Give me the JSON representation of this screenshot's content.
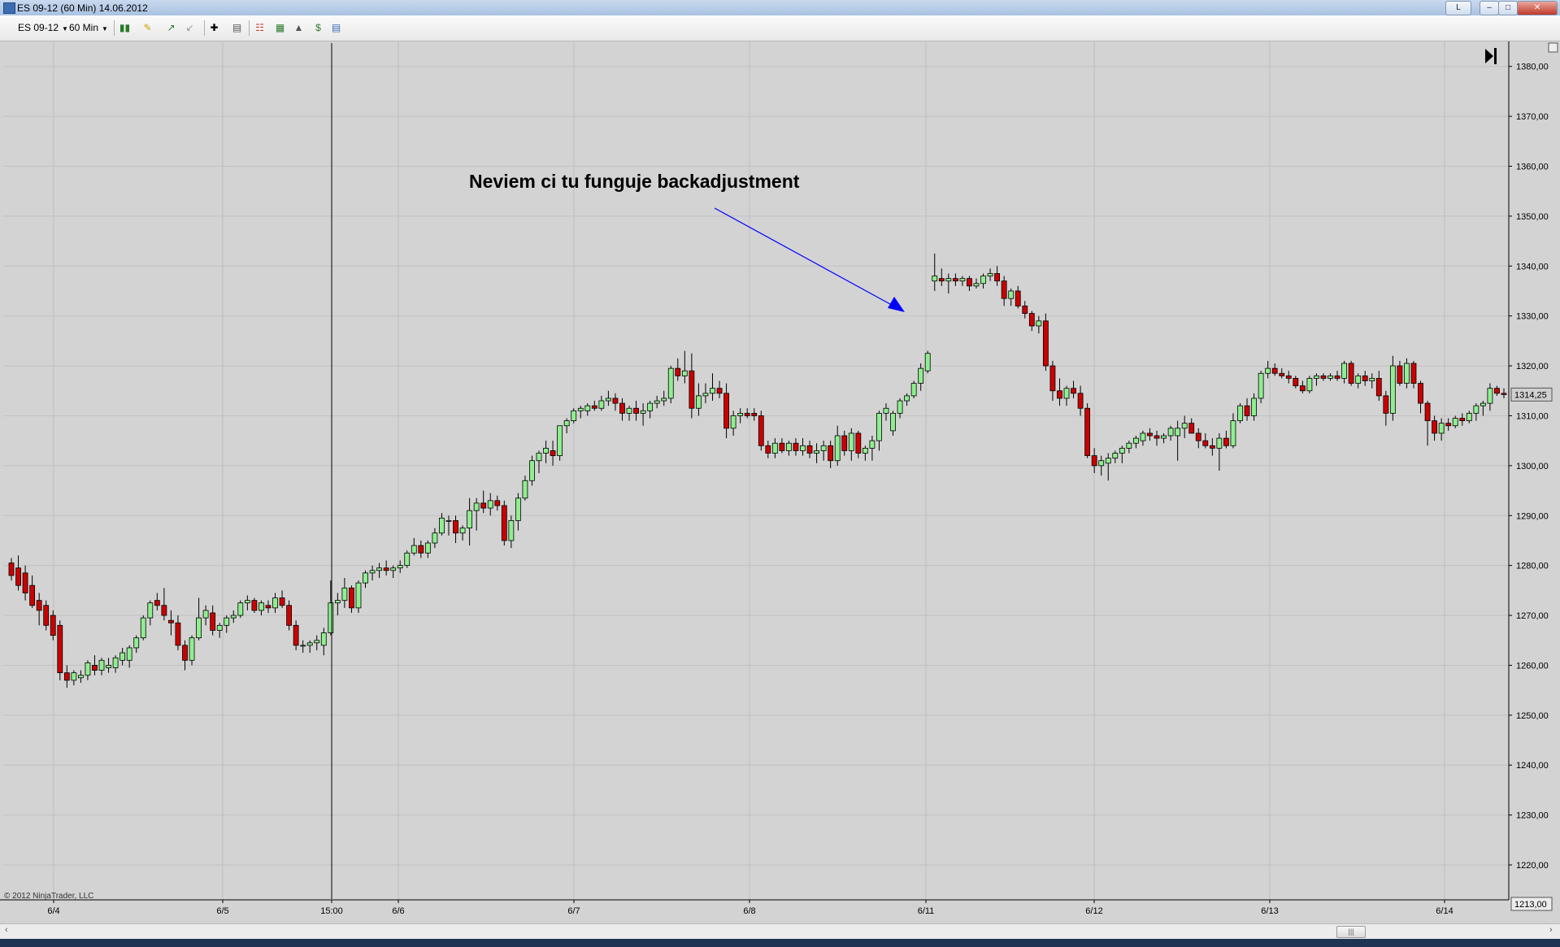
{
  "window": {
    "title": "ES 09-12 (60 Min)  14.06.2012"
  },
  "toolbar": {
    "instrument": "ES 09-12",
    "interval": "60 Min"
  },
  "chart_data": {
    "type": "candlestick",
    "instrument": "ES 09-12",
    "interval": "60 Min",
    "ylim": [
      1213.0,
      1385.0
    ],
    "y_ticks": [
      "1220,00",
      "1230,00",
      "1240,00",
      "1250,00",
      "1260,00",
      "1270,00",
      "1280,00",
      "1290,00",
      "1300,00",
      "1310,00",
      "1320,00",
      "1330,00",
      "1340,00",
      "1350,00",
      "1360,00",
      "1370,00",
      "1380,00"
    ],
    "x_tick_labels": [
      "6/4",
      "6/5",
      "15:00",
      "6/6",
      "6/7",
      "6/8",
      "6/11",
      "6/12",
      "6/13",
      "6/14"
    ],
    "last_price_label": "1314,25",
    "bottom_price_label": "1213,00",
    "annotation_text": "Neviem ci tu funguje backadjustment",
    "copyright": "© 2012 NinjaTrader, LLC",
    "colors": {
      "up": "#90ee90",
      "down": "#cc0000",
      "outline": "#000000",
      "background": "#d3d3d3",
      "arrow": "#0000ff"
    },
    "candles_ohlc": [
      [
        1280.5,
        1281.5,
        1277.0,
        1278.0
      ],
      [
        1279.5,
        1282.0,
        1275.0,
        1276.0
      ],
      [
        1278.5,
        1280.0,
        1273.0,
        1274.5
      ],
      [
        1276.0,
        1278.0,
        1271.5,
        1272.0
      ],
      [
        1273.0,
        1274.5,
        1268.0,
        1271.0
      ],
      [
        1272.0,
        1273.0,
        1267.0,
        1268.0
      ],
      [
        1270.0,
        1271.0,
        1265.0,
        1266.0
      ],
      [
        1268.0,
        1269.0,
        1257.0,
        1258.5
      ],
      [
        1258.5,
        1260.0,
        1255.5,
        1257.0
      ],
      [
        1257.0,
        1259.0,
        1256.0,
        1258.5
      ],
      [
        1257.5,
        1259.0,
        1256.5,
        1258.0
      ],
      [
        1258.0,
        1261.0,
        1257.0,
        1260.5
      ],
      [
        1260.0,
        1262.0,
        1258.0,
        1259.0
      ],
      [
        1259.0,
        1261.5,
        1258.0,
        1261.0
      ],
      [
        1259.5,
        1261.5,
        1258.5,
        1260.0
      ],
      [
        1259.5,
        1262.0,
        1258.5,
        1261.5
      ],
      [
        1261.0,
        1263.5,
        1260.0,
        1262.5
      ],
      [
        1261.0,
        1264.0,
        1259.5,
        1263.5
      ],
      [
        1263.5,
        1266.0,
        1262.5,
        1265.5
      ],
      [
        1265.5,
        1270.0,
        1265.0,
        1269.5
      ],
      [
        1269.5,
        1273.0,
        1268.0,
        1272.5
      ],
      [
        1273.0,
        1274.5,
        1271.0,
        1272.0
      ],
      [
        1272.0,
        1275.5,
        1269.0,
        1270.0
      ],
      [
        1269.0,
        1271.0,
        1266.0,
        1268.5
      ],
      [
        1268.5,
        1270.0,
        1263.0,
        1264.0
      ],
      [
        1264.0,
        1265.0,
        1259.0,
        1261.0
      ],
      [
        1261.0,
        1266.0,
        1260.0,
        1265.5
      ],
      [
        1265.5,
        1273.5,
        1265.0,
        1269.5
      ],
      [
        1269.5,
        1272.0,
        1268.0,
        1271.0
      ],
      [
        1270.5,
        1272.0,
        1266.0,
        1267.0
      ],
      [
        1267.0,
        1268.5,
        1265.5,
        1268.0
      ],
      [
        1268.0,
        1270.0,
        1266.5,
        1269.5
      ],
      [
        1269.5,
        1271.0,
        1268.5,
        1270.0
      ],
      [
        1270.0,
        1273.0,
        1269.5,
        1272.5
      ],
      [
        1272.5,
        1274.0,
        1271.0,
        1273.0
      ],
      [
        1273.0,
        1273.5,
        1270.5,
        1271.0
      ],
      [
        1271.0,
        1273.0,
        1270.0,
        1272.5
      ],
      [
        1272.0,
        1273.0,
        1270.5,
        1271.5
      ],
      [
        1271.5,
        1274.5,
        1270.5,
        1273.5
      ],
      [
        1273.5,
        1275.0,
        1271.5,
        1272.0
      ],
      [
        1272.0,
        1273.0,
        1267.0,
        1268.0
      ],
      [
        1268.0,
        1269.0,
        1263.0,
        1264.0
      ],
      [
        1264.0,
        1265.0,
        1262.5,
        1264.0
      ],
      [
        1264.0,
        1265.0,
        1262.5,
        1264.5
      ],
      [
        1264.5,
        1266.0,
        1263.0,
        1265.0
      ],
      [
        1264.0,
        1267.5,
        1262.0,
        1266.5
      ],
      [
        1266.5,
        1277.0,
        1266.0,
        1272.5
      ],
      [
        1272.5,
        1274.5,
        1270.0,
        1273.0
      ],
      [
        1273.0,
        1277.5,
        1271.5,
        1275.5
      ],
      [
        1275.5,
        1276.0,
        1270.5,
        1271.5
      ],
      [
        1271.5,
        1277.0,
        1270.5,
        1276.5
      ],
      [
        1276.5,
        1279.0,
        1275.5,
        1278.5
      ],
      [
        1278.5,
        1280.0,
        1277.0,
        1279.0
      ],
      [
        1279.0,
        1280.5,
        1277.5,
        1279.5
      ],
      [
        1279.5,
        1281.0,
        1278.0,
        1279.0
      ],
      [
        1279.0,
        1280.0,
        1277.5,
        1279.5
      ],
      [
        1279.5,
        1281.0,
        1278.5,
        1280.0
      ],
      [
        1280.0,
        1283.0,
        1279.5,
        1282.5
      ],
      [
        1282.5,
        1285.5,
        1282.0,
        1284.0
      ],
      [
        1284.0,
        1285.0,
        1281.5,
        1282.5
      ],
      [
        1282.5,
        1285.0,
        1281.5,
        1284.5
      ],
      [
        1284.5,
        1287.5,
        1283.5,
        1286.5
      ],
      [
        1286.5,
        1290.5,
        1286.0,
        1289.5
      ],
      [
        1289.0,
        1290.0,
        1286.0,
        1289.0
      ],
      [
        1289.0,
        1290.0,
        1284.5,
        1286.5
      ],
      [
        1286.5,
        1288.0,
        1285.0,
        1287.5
      ],
      [
        1287.5,
        1293.5,
        1284.0,
        1291.0
      ],
      [
        1291.0,
        1293.5,
        1287.0,
        1292.5
      ],
      [
        1292.5,
        1295.0,
        1290.5,
        1291.5
      ],
      [
        1291.5,
        1294.5,
        1290.0,
        1293.0
      ],
      [
        1293.0,
        1294.0,
        1291.0,
        1292.0
      ],
      [
        1292.0,
        1293.0,
        1284.0,
        1285.0
      ],
      [
        1285.0,
        1290.0,
        1283.5,
        1289.0
      ],
      [
        1289.0,
        1294.5,
        1287.0,
        1293.5
      ],
      [
        1293.5,
        1298.0,
        1293.0,
        1297.0
      ],
      [
        1297.0,
        1302.0,
        1296.0,
        1301.0
      ],
      [
        1301.0,
        1303.0,
        1298.5,
        1302.5
      ],
      [
        1302.5,
        1305.0,
        1300.5,
        1303.5
      ],
      [
        1303.0,
        1305.0,
        1300.0,
        1302.0
      ],
      [
        1302.0,
        1307.5,
        1301.0,
        1308.0
      ],
      [
        1308.0,
        1309.5,
        1306.5,
        1309.0
      ],
      [
        1309.0,
        1311.5,
        1308.5,
        1311.0
      ],
      [
        1311.0,
        1312.0,
        1309.5,
        1311.5
      ],
      [
        1311.0,
        1312.5,
        1310.0,
        1312.0
      ],
      [
        1312.0,
        1313.0,
        1311.0,
        1311.5
      ],
      [
        1311.5,
        1314.0,
        1311.0,
        1313.0
      ],
      [
        1313.0,
        1315.0,
        1312.0,
        1313.5
      ],
      [
        1313.5,
        1314.5,
        1311.0,
        1312.5
      ],
      [
        1312.5,
        1313.5,
        1309.0,
        1310.5
      ],
      [
        1310.5,
        1312.0,
        1309.0,
        1311.5
      ],
      [
        1311.5,
        1313.0,
        1309.0,
        1310.5
      ],
      [
        1310.5,
        1312.5,
        1308.0,
        1311.0
      ],
      [
        1311.0,
        1313.0,
        1309.5,
        1312.5
      ],
      [
        1312.5,
        1314.0,
        1311.5,
        1313.0
      ],
      [
        1313.0,
        1315.0,
        1312.0,
        1313.5
      ],
      [
        1313.5,
        1320.0,
        1312.5,
        1319.5
      ],
      [
        1319.5,
        1321.5,
        1317.0,
        1318.0
      ],
      [
        1318.0,
        1323.0,
        1316.5,
        1319.0
      ],
      [
        1319.0,
        1322.5,
        1309.5,
        1311.5
      ],
      [
        1311.5,
        1316.5,
        1310.0,
        1314.0
      ],
      [
        1314.0,
        1316.5,
        1312.5,
        1314.5
      ],
      [
        1314.5,
        1318.5,
        1313.0,
        1315.5
      ],
      [
        1315.5,
        1317.0,
        1313.5,
        1314.5
      ],
      [
        1314.5,
        1316.5,
        1305.5,
        1307.5
      ],
      [
        1307.5,
        1311.0,
        1306.0,
        1310.0
      ],
      [
        1310.0,
        1311.5,
        1308.5,
        1310.5
      ],
      [
        1310.5,
        1311.5,
        1309.5,
        1310.0
      ],
      [
        1310.5,
        1311.5,
        1309.0,
        1310.0
      ],
      [
        1310.0,
        1311.0,
        1303.0,
        1304.0
      ],
      [
        1304.0,
        1305.0,
        1301.5,
        1302.5
      ],
      [
        1302.5,
        1305.5,
        1301.5,
        1304.5
      ],
      [
        1304.5,
        1305.5,
        1302.5,
        1303.0
      ],
      [
        1303.0,
        1305.0,
        1302.0,
        1304.5
      ],
      [
        1304.5,
        1305.5,
        1302.0,
        1303.0
      ],
      [
        1303.0,
        1305.5,
        1302.0,
        1304.0
      ],
      [
        1304.0,
        1305.0,
        1301.5,
        1302.5
      ],
      [
        1302.5,
        1304.5,
        1300.5,
        1303.0
      ],
      [
        1303.0,
        1305.0,
        1301.0,
        1304.0
      ],
      [
        1304.0,
        1305.0,
        1299.5,
        1301.0
      ],
      [
        1301.0,
        1308.0,
        1300.0,
        1306.0
      ],
      [
        1306.0,
        1307.0,
        1302.0,
        1303.0
      ],
      [
        1303.0,
        1307.5,
        1301.0,
        1306.5
      ],
      [
        1306.5,
        1307.0,
        1301.5,
        1302.5
      ],
      [
        1302.5,
        1304.0,
        1301.0,
        1303.5
      ],
      [
        1303.5,
        1306.0,
        1301.0,
        1305.0
      ],
      [
        1305.0,
        1311.0,
        1303.0,
        1310.5
      ],
      [
        1310.5,
        1312.5,
        1309.0,
        1311.5
      ],
      [
        1307.0,
        1311.0,
        1306.0,
        1310.5
      ],
      [
        1310.5,
        1313.5,
        1309.5,
        1313.0
      ],
      [
        1313.0,
        1314.5,
        1312.0,
        1314.0
      ],
      [
        1314.0,
        1317.0,
        1313.5,
        1316.5
      ],
      [
        1316.5,
        1320.5,
        1315.0,
        1319.5
      ],
      [
        1319.0,
        1323.0,
        1318.5,
        1322.5
      ],
      [
        1337.0,
        1342.5,
        1335.0,
        1338.0
      ],
      [
        1337.5,
        1339.5,
        1336.0,
        1337.0
      ],
      [
        1337.0,
        1338.5,
        1334.5,
        1337.5
      ],
      [
        1337.5,
        1338.5,
        1336.0,
        1337.0
      ],
      [
        1337.0,
        1338.0,
        1336.0,
        1337.5
      ],
      [
        1337.5,
        1338.0,
        1335.0,
        1336.0
      ],
      [
        1336.0,
        1337.5,
        1335.5,
        1336.5
      ],
      [
        1336.5,
        1338.5,
        1335.5,
        1338.0
      ],
      [
        1338.0,
        1339.5,
        1337.0,
        1338.5
      ],
      [
        1338.5,
        1340.0,
        1336.0,
        1337.0
      ],
      [
        1337.0,
        1338.0,
        1332.0,
        1333.5
      ],
      [
        1333.5,
        1335.5,
        1332.0,
        1335.0
      ],
      [
        1335.0,
        1336.0,
        1331.5,
        1332.0
      ],
      [
        1332.0,
        1333.0,
        1329.5,
        1330.5
      ],
      [
        1330.5,
        1331.0,
        1327.0,
        1328.0
      ],
      [
        1328.0,
        1330.0,
        1326.5,
        1329.0
      ],
      [
        1329.0,
        1330.5,
        1319.0,
        1320.0
      ],
      [
        1320.0,
        1321.0,
        1313.0,
        1315.0
      ],
      [
        1315.0,
        1317.5,
        1312.0,
        1313.5
      ],
      [
        1313.5,
        1316.0,
        1312.0,
        1315.5
      ],
      [
        1315.5,
        1317.0,
        1313.5,
        1314.5
      ],
      [
        1314.5,
        1316.0,
        1310.0,
        1311.5
      ],
      [
        1311.5,
        1312.5,
        1301.5,
        1302.0
      ],
      [
        1302.0,
        1303.5,
        1298.5,
        1300.0
      ],
      [
        1300.0,
        1302.0,
        1298.0,
        1301.0
      ],
      [
        1300.5,
        1302.5,
        1297.0,
        1301.5
      ],
      [
        1301.5,
        1303.0,
        1300.5,
        1302.5
      ],
      [
        1302.5,
        1304.0,
        1300.5,
        1303.5
      ],
      [
        1303.5,
        1305.0,
        1302.5,
        1304.5
      ],
      [
        1304.5,
        1306.0,
        1303.5,
        1305.5
      ],
      [
        1305.0,
        1307.0,
        1304.0,
        1306.5
      ],
      [
        1306.5,
        1307.5,
        1305.0,
        1306.0
      ],
      [
        1306.0,
        1307.0,
        1304.0,
        1305.5
      ],
      [
        1305.5,
        1306.5,
        1304.5,
        1306.0
      ],
      [
        1306.0,
        1308.0,
        1305.0,
        1307.5
      ],
      [
        1306.0,
        1309.0,
        1301.0,
        1307.5
      ],
      [
        1307.5,
        1310.0,
        1305.5,
        1308.5
      ],
      [
        1308.5,
        1309.5,
        1306.5,
        1306.5
      ],
      [
        1306.5,
        1307.5,
        1303.5,
        1305.0
      ],
      [
        1305.0,
        1306.5,
        1303.5,
        1304.0
      ],
      [
        1304.0,
        1305.5,
        1302.0,
        1303.5
      ],
      [
        1303.5,
        1306.5,
        1299.0,
        1305.5
      ],
      [
        1305.5,
        1307.0,
        1303.5,
        1304.0
      ],
      [
        1304.0,
        1310.5,
        1303.5,
        1309.0
      ],
      [
        1309.0,
        1312.5,
        1308.5,
        1312.0
      ],
      [
        1312.0,
        1313.5,
        1309.0,
        1310.0
      ],
      [
        1310.0,
        1314.5,
        1309.0,
        1313.5
      ],
      [
        1313.5,
        1319.0,
        1312.5,
        1318.5
      ],
      [
        1318.5,
        1321.0,
        1317.5,
        1319.5
      ],
      [
        1319.5,
        1320.5,
        1318.0,
        1318.5
      ],
      [
        1318.5,
        1319.5,
        1317.5,
        1318.0
      ],
      [
        1318.0,
        1319.0,
        1316.5,
        1317.5
      ],
      [
        1317.5,
        1318.0,
        1315.5,
        1316.0
      ],
      [
        1316.0,
        1317.0,
        1314.5,
        1315.0
      ],
      [
        1315.0,
        1318.0,
        1314.5,
        1317.5
      ],
      [
        1317.5,
        1318.5,
        1316.0,
        1318.0
      ],
      [
        1318.0,
        1318.5,
        1317.0,
        1317.5
      ],
      [
        1317.5,
        1318.5,
        1317.0,
        1318.0
      ],
      [
        1318.0,
        1319.0,
        1317.0,
        1317.5
      ],
      [
        1317.5,
        1321.0,
        1316.5,
        1320.5
      ],
      [
        1320.5,
        1321.0,
        1316.0,
        1316.5
      ],
      [
        1316.5,
        1318.5,
        1315.5,
        1318.0
      ],
      [
        1318.0,
        1319.0,
        1316.0,
        1317.0
      ],
      [
        1317.0,
        1318.5,
        1315.5,
        1317.5
      ],
      [
        1317.5,
        1319.0,
        1313.0,
        1314.0
      ],
      [
        1314.0,
        1315.0,
        1308.0,
        1310.5
      ],
      [
        1310.5,
        1322.0,
        1309.0,
        1320.0
      ],
      [
        1320.0,
        1321.0,
        1316.0,
        1316.5
      ],
      [
        1316.5,
        1321.5,
        1315.5,
        1320.5
      ],
      [
        1320.5,
        1321.0,
        1315.5,
        1316.5
      ],
      [
        1316.5,
        1317.0,
        1310.5,
        1312.5
      ],
      [
        1312.5,
        1313.0,
        1304.0,
        1309.0
      ],
      [
        1309.0,
        1310.0,
        1305.0,
        1306.5
      ],
      [
        1306.5,
        1309.5,
        1305.0,
        1308.5
      ],
      [
        1308.5,
        1309.5,
        1307.0,
        1308.0
      ],
      [
        1308.0,
        1310.0,
        1307.5,
        1309.5
      ],
      [
        1309.5,
        1310.5,
        1308.0,
        1309.0
      ],
      [
        1309.0,
        1311.0,
        1308.5,
        1310.5
      ],
      [
        1310.5,
        1312.5,
        1309.0,
        1312.0
      ],
      [
        1312.0,
        1313.0,
        1310.0,
        1312.5
      ],
      [
        1312.5,
        1316.5,
        1311.0,
        1315.5
      ],
      [
        1315.5,
        1316.0,
        1314.0,
        1314.5
      ],
      [
        1314.5,
        1315.5,
        1313.5,
        1314.25
      ]
    ]
  }
}
